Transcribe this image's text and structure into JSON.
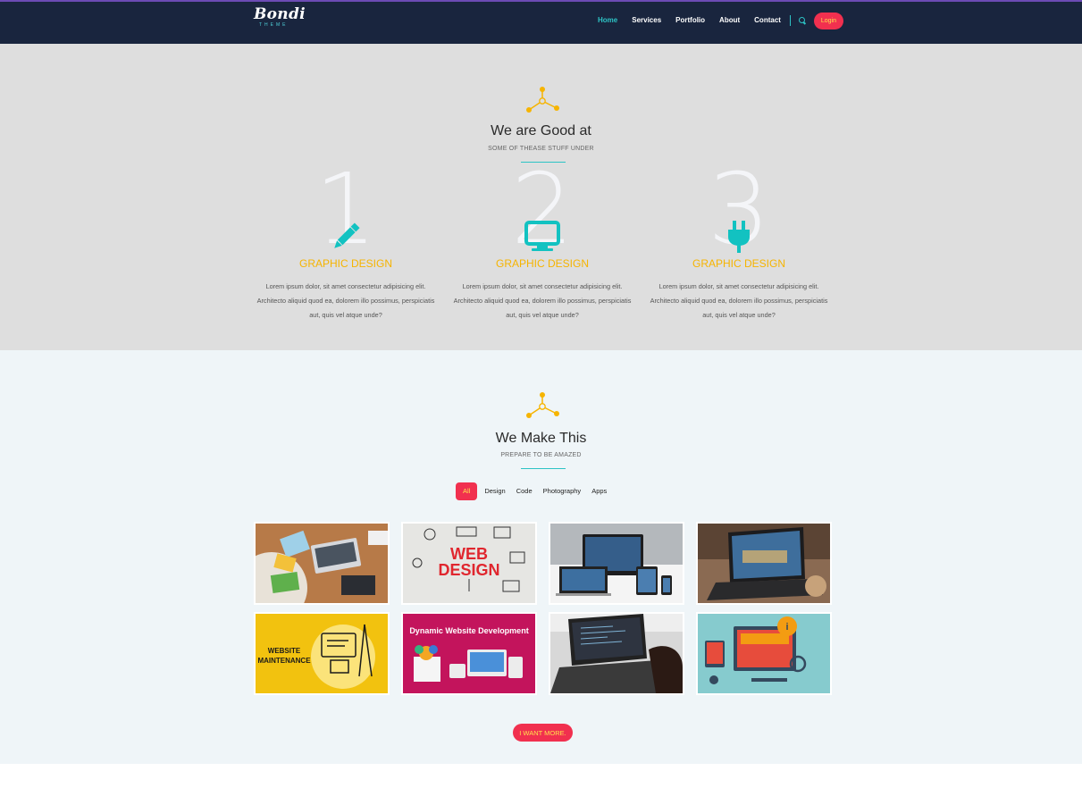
{
  "brand": {
    "name": "Bondi",
    "tagline": "THEME"
  },
  "nav": {
    "items": [
      "Home",
      "Services",
      "Portfolio",
      "About",
      "Contact"
    ],
    "active": "Home",
    "search_icon": "search-icon",
    "login_label": "Login"
  },
  "colors": {
    "navy": "#19253e",
    "teal": "#2dc3c5",
    "accent_red": "#f1304f",
    "accent_yellow": "#f6b400",
    "section1_bg": "#dedede",
    "section2_bg": "#eff5f8"
  },
  "services_section": {
    "title": "We are Good at",
    "subtitle": "SOME OF THEASE STUFF UNDER",
    "items": [
      {
        "number": "1",
        "icon": "pencil-icon",
        "title": "GRAPHIC DESIGN",
        "description": "Lorem ipsum dolor, sit amet consectetur adipisicing elit. Architecto aliquid quod ea, dolorem illo possimus, perspiciatis aut, quis vel atque unde?"
      },
      {
        "number": "2",
        "icon": "monitor-icon",
        "title": "GRAPHIC DESIGN",
        "description": "Lorem ipsum dolor, sit amet consectetur adipisicing elit. Architecto aliquid quod ea, dolorem illo possimus, perspiciatis aut, quis vel atque unde?"
      },
      {
        "number": "3",
        "icon": "plug-icon",
        "title": "GRAPHIC DESIGN",
        "description": "Lorem ipsum dolor, sit amet consectetur adipisicing elit. Architecto aliquid quod ea, dolorem illo possimus, perspiciatis aut, quis vel atque unde?"
      }
    ]
  },
  "portfolio_section": {
    "title": "We Make This",
    "subtitle": "PREPARE TO BE AMAZED",
    "filters": [
      "All",
      "Design",
      "Code",
      "Photography",
      "Apps"
    ],
    "active_filter": "All",
    "tiles": [
      {
        "label": ""
      },
      {
        "label": "WEB DESIGN"
      },
      {
        "label": ""
      },
      {
        "label": ""
      },
      {
        "label": "WEBSITE MAINTENANCE"
      },
      {
        "label": "Dynamic Website Development"
      },
      {
        "label": ""
      },
      {
        "label": ""
      }
    ],
    "more_label": "I WANT MORE."
  }
}
